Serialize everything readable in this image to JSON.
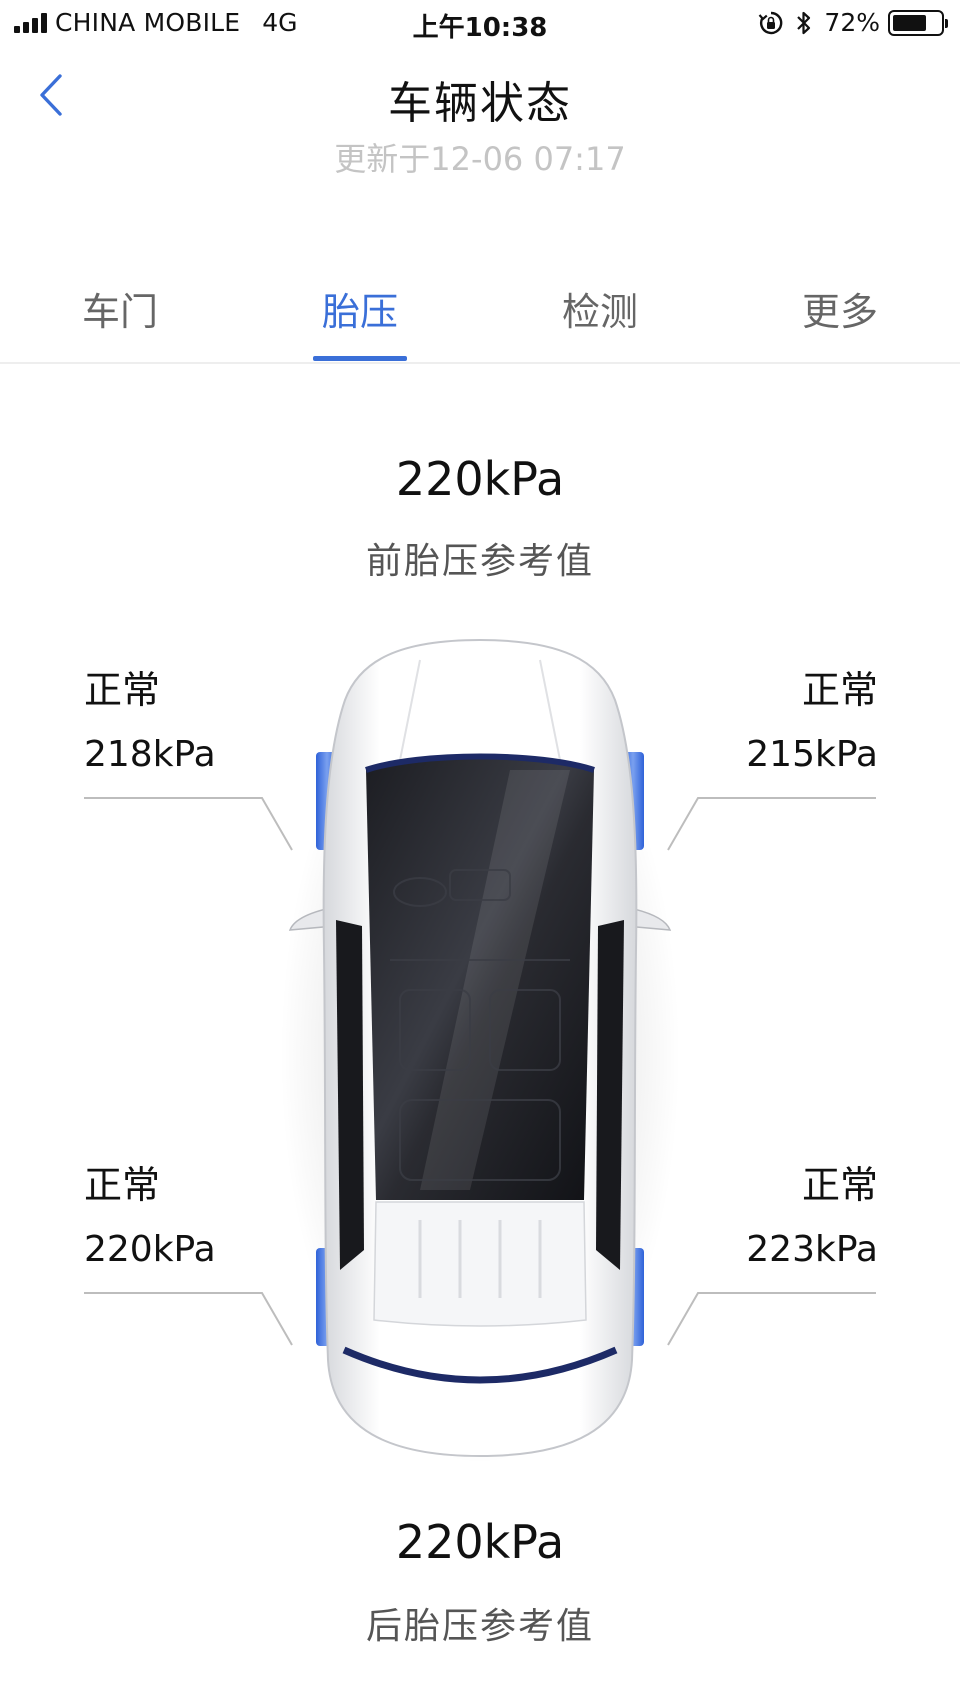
{
  "status_bar": {
    "carrier": "CHINA MOBILE",
    "network": "4G",
    "time": "上午10:38",
    "battery": "72%",
    "battery_level": 0.72,
    "icons": [
      "signal-icon",
      "rotation-lock-icon",
      "bluetooth-icon",
      "battery-icon"
    ]
  },
  "header": {
    "title": "车辆状态",
    "updated": "更新于12-06 07:17",
    "back_icon": "chevron-left-icon"
  },
  "tabs": [
    {
      "label": "车门",
      "active": false
    },
    {
      "label": "胎压",
      "active": true
    },
    {
      "label": "检测",
      "active": false
    },
    {
      "label": "更多",
      "active": false
    }
  ],
  "front_reference": {
    "value": "220kPa",
    "label": "前胎压参考值"
  },
  "rear_reference": {
    "value": "220kPa",
    "label": "后胎压参考值"
  },
  "tires": {
    "front_left": {
      "status": "正常",
      "pressure": "218kPa"
    },
    "front_right": {
      "status": "正常",
      "pressure": "215kPa"
    },
    "rear_left": {
      "status": "正常",
      "pressure": "220kPa"
    },
    "rear_right": {
      "status": "正常",
      "pressure": "223kPa"
    }
  },
  "colors": {
    "accent": "#3a6fd8",
    "tire_highlight": "#3d73e0",
    "muted_text": "#c4c4c4"
  }
}
